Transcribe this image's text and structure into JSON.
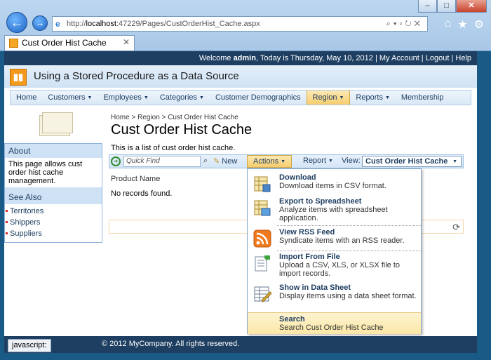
{
  "browser": {
    "address_prefix": "http://",
    "address_host": "localhost",
    "address_rest": ":47229/Pages/CustOrderHist_Cache.aspx",
    "tab_title": "Cust Order Hist Cache",
    "window_minimize": "–",
    "window_maximize": "□",
    "window_close": "✕",
    "status_text": "javascript:"
  },
  "topbar": {
    "welcome_prefix": "Welcome ",
    "user": "admin",
    "welcome_suffix": ", Today is Thursday, May 10, 2012",
    "sep": " | ",
    "my_account": "My Account",
    "logout": "Logout",
    "help": "Help"
  },
  "app": {
    "title": "Using a Stored Procedure as a Data Source"
  },
  "menu": [
    {
      "label": "Home",
      "caret": false
    },
    {
      "label": "Customers",
      "caret": true
    },
    {
      "label": "Employees",
      "caret": true
    },
    {
      "label": "Categories",
      "caret": true
    },
    {
      "label": "Customer Demographics",
      "caret": false
    },
    {
      "label": "Region",
      "caret": true,
      "active": true
    },
    {
      "label": "Reports",
      "caret": true
    },
    {
      "label": "Membership",
      "caret": false
    }
  ],
  "sidebar": {
    "about_title": "About",
    "about_text": "This page allows cust order hist cache management.",
    "see_also_title": "See Also",
    "links": [
      "Territories",
      "Shippers",
      "Suppliers"
    ]
  },
  "breadcrumb": {
    "home": "Home",
    "sep": ">",
    "region": "Region",
    "current": "Cust Order Hist Cache"
  },
  "page": {
    "title": "Cust Order Hist Cache",
    "description": "This is a list of cust order hist cache."
  },
  "actionbar": {
    "quick_find_placeholder": "Quick Find",
    "new_label": "New",
    "actions_label": "Actions",
    "report_label": "Report",
    "view_label": "View:",
    "view_value": "Cust Order Hist Cache"
  },
  "grid": {
    "column_header": "Product Name",
    "empty_text": "No records found."
  },
  "actions_menu": [
    {
      "title": "Download",
      "desc": "Download items in CSV format.",
      "icon": "download-icon"
    },
    {
      "title": "Export to Spreadsheet",
      "desc": "Analyze items with spreadsheet application.",
      "icon": "spreadsheet-icon"
    },
    {
      "title": "View RSS Feed",
      "desc": "Syndicate items with an RSS reader.",
      "icon": "rss-icon"
    },
    {
      "title": "Import From File",
      "desc": "Upload a CSV, XLS, or XLSX file to import records.",
      "icon": "import-icon"
    },
    {
      "title": "Show in Data Sheet",
      "desc": "Display items using a data sheet format.",
      "icon": "datasheet-icon"
    },
    {
      "title": "Search",
      "desc": "Search Cust Order Hist Cache",
      "icon": "search-icon"
    }
  ],
  "footer": {
    "copyright": "© 2012 MyCompany. All rights reserved."
  }
}
